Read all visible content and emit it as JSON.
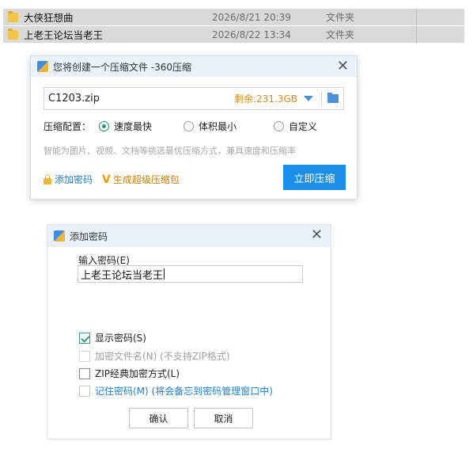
{
  "files": [
    {
      "name": "大侠狂想曲",
      "date": "2026/8/21 20:39",
      "type": "文件夹"
    },
    {
      "name": "上老王论坛当老王",
      "date": "2026/8/22 13:34",
      "type": "文件夹"
    }
  ],
  "compress_dialog": {
    "title": "您将创建一个压缩文件 -360压缩",
    "archive_name": "C1203.zip",
    "free_space": "剩余:231.3GB",
    "config_label": "压缩配置：",
    "options": [
      "速度最快",
      "体积最小",
      "自定义"
    ],
    "selected_option": "速度最快",
    "hint": "智能为图片、视频、文档等挑选最优压缩方式，兼具速度和压缩率",
    "add_password_link": "添加密码",
    "super_archive_link": "生成超级压缩包",
    "compress_button": "立即压缩"
  },
  "password_dialog": {
    "title": "添加密码",
    "input_label": "输入密码(E)",
    "password_value": "上老王论坛当老王",
    "checkboxes": [
      {
        "label": "显示密码(S)",
        "checked": true
      },
      {
        "label": "加密文件名(N) (不支持ZIP格式)",
        "checked": false,
        "disabled": true
      },
      {
        "label": "ZIP经典加密方式(L)",
        "checked": false
      },
      {
        "label": "记住密码(M) (将会备忘到密码管理窗口中)",
        "checked": false
      }
    ],
    "ok_button": "确认",
    "cancel_button": "取消"
  },
  "colors": {
    "accent_blue": "#1a8ee8",
    "link_orange": "#d67c00",
    "radio_green": "#1aa06d",
    "free_space_orange": "#e08a14"
  },
  "icons": {
    "folder": "folder-icon",
    "app": "360zip-icon",
    "close": "close-icon",
    "lock": "lock-icon",
    "vip": "v-icon",
    "dropdown": "chevron-down-icon",
    "browse": "browse-folder-icon"
  }
}
